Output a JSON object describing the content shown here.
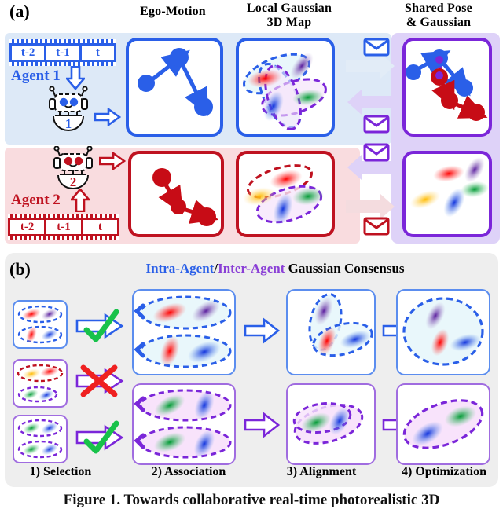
{
  "figure": {
    "panel_a_label": "(a)",
    "panel_b_label": "(b)",
    "caption": "Figure 1.   Towards collaborative real-time photorealistic 3D"
  },
  "panel_a": {
    "column_headers": [
      {
        "name": "ego-motion",
        "line1": "Ego-Motion",
        "line2": ""
      },
      {
        "name": "local-gaussian-3d-map",
        "line1": "Local Gaussian",
        "line2": "3D Map"
      },
      {
        "name": "shared-pose-and-gaussian",
        "line1": "Shared Pose",
        "line2": "& Gaussian"
      }
    ],
    "agents": [
      {
        "id": "agent-1",
        "label": "Agent 1",
        "color": "#2a5fe8",
        "robot_number": "1",
        "frames": [
          "t-2",
          "t-1",
          "t"
        ]
      },
      {
        "id": "agent-2",
        "label": "Agent 2",
        "color": "#bf1220",
        "robot_number": "2",
        "frames": [
          "t-2",
          "t-1",
          "t"
        ]
      }
    ],
    "messages": [
      {
        "name": "message-upload-agent1",
        "icon": "envelope-icon",
        "color": "#2a5fe8"
      },
      {
        "name": "message-download-agent1",
        "icon": "envelope-icon",
        "color": "#7b26d9"
      },
      {
        "name": "message-download-agent2",
        "icon": "envelope-icon",
        "color": "#7b26d9"
      },
      {
        "name": "message-upload-agent2",
        "icon": "envelope-icon",
        "color": "#bf1220"
      }
    ]
  },
  "panel_b": {
    "title_parts": [
      {
        "text": "Intra-Agent",
        "color": "#2a5fe8"
      },
      {
        "text": "/",
        "color": "#000000"
      },
      {
        "text": "Inter-Agent",
        "color": "#8a3fd6"
      },
      {
        "text": " Gaussian Consensus",
        "color": "#000000"
      }
    ],
    "steps": [
      {
        "index": "1",
        "label": "1) Selection"
      },
      {
        "index": "2",
        "label": "2) Association"
      },
      {
        "index": "3",
        "label": "3) Alignment"
      },
      {
        "index": "4",
        "label": "4) Optimization"
      }
    ],
    "selection_rows": [
      {
        "name": "selection-intra-agent",
        "verdict": "check",
        "verdict_color": "#18c24a",
        "arrow_color": "#2a5fe8"
      },
      {
        "name": "selection-inter-agent-rejected",
        "verdict": "cross",
        "verdict_color": "#ef2020",
        "arrow_color": "#7b26d9"
      },
      {
        "name": "selection-inter-agent-accepted",
        "verdict": "check",
        "verdict_color": "#18c24a",
        "arrow_color": "#7b26d9"
      }
    ]
  },
  "colors": {
    "agent1_blue": "#2a5fe8",
    "agent2_red": "#bf1220",
    "shared_purple": "#7b26d9",
    "band_blue": "#dde9f7",
    "band_red": "#f9dcdf",
    "band_purple": "#ded2f8",
    "band_grey": "#eeeeee",
    "check_green": "#18c24a",
    "cross_red": "#ef2020",
    "gauss_red": "#ef2b2b",
    "gauss_blue": "#2f6be0",
    "gauss_green": "#22aa4e",
    "gauss_purple": "#6a2fae",
    "gauss_yellow": "#f2b922"
  }
}
